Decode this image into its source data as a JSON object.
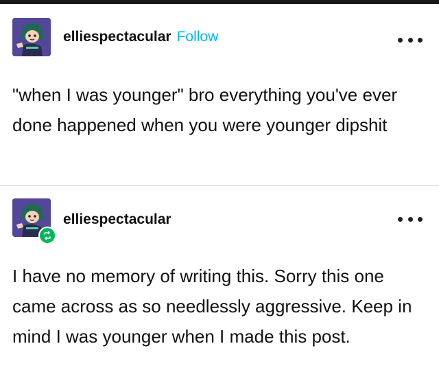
{
  "posts": [
    {
      "username": "elliespectacular",
      "follow_label": "Follow",
      "text": "\"when I was younger\" bro everything you've ever done happened when you were younger dipshit"
    },
    {
      "username": "elliespectacular",
      "text": "I have no memory of writing this. Sorry this one came across as so needlessly aggressive. Keep in mind I was younger when I made this post."
    }
  ],
  "icons": {
    "more": "more-options-icon",
    "reblog": "reblog-icon",
    "avatar": "avatar"
  },
  "colors": {
    "follow": "#00b8ff",
    "reblog_badge": "#00b85c",
    "avatar_bg": "#4a3f8c"
  }
}
